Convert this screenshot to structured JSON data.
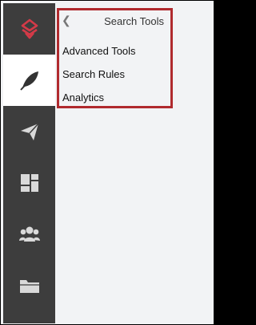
{
  "nav_rail": {
    "items": [
      {
        "icon": "logo-icon",
        "active": false
      },
      {
        "icon": "feather-icon",
        "active": true
      },
      {
        "icon": "paper-plane-icon",
        "active": false
      },
      {
        "icon": "dashboard-icon",
        "active": false
      },
      {
        "icon": "users-icon",
        "active": false
      },
      {
        "icon": "folder-icon",
        "active": false
      }
    ],
    "colors": {
      "rail_bg": "#3d3d3d",
      "icon": "#d9d9d9",
      "brand": "#d33a48",
      "active_bg": "#ffffff",
      "active_icon": "#333333"
    }
  },
  "search_tools_menu": {
    "title": "Search Tools",
    "back_icon": "chevron-left-icon",
    "items": [
      "Advanced Tools",
      "Search Rules",
      "Analytics"
    ],
    "highlight_color": "#b02a2e"
  }
}
